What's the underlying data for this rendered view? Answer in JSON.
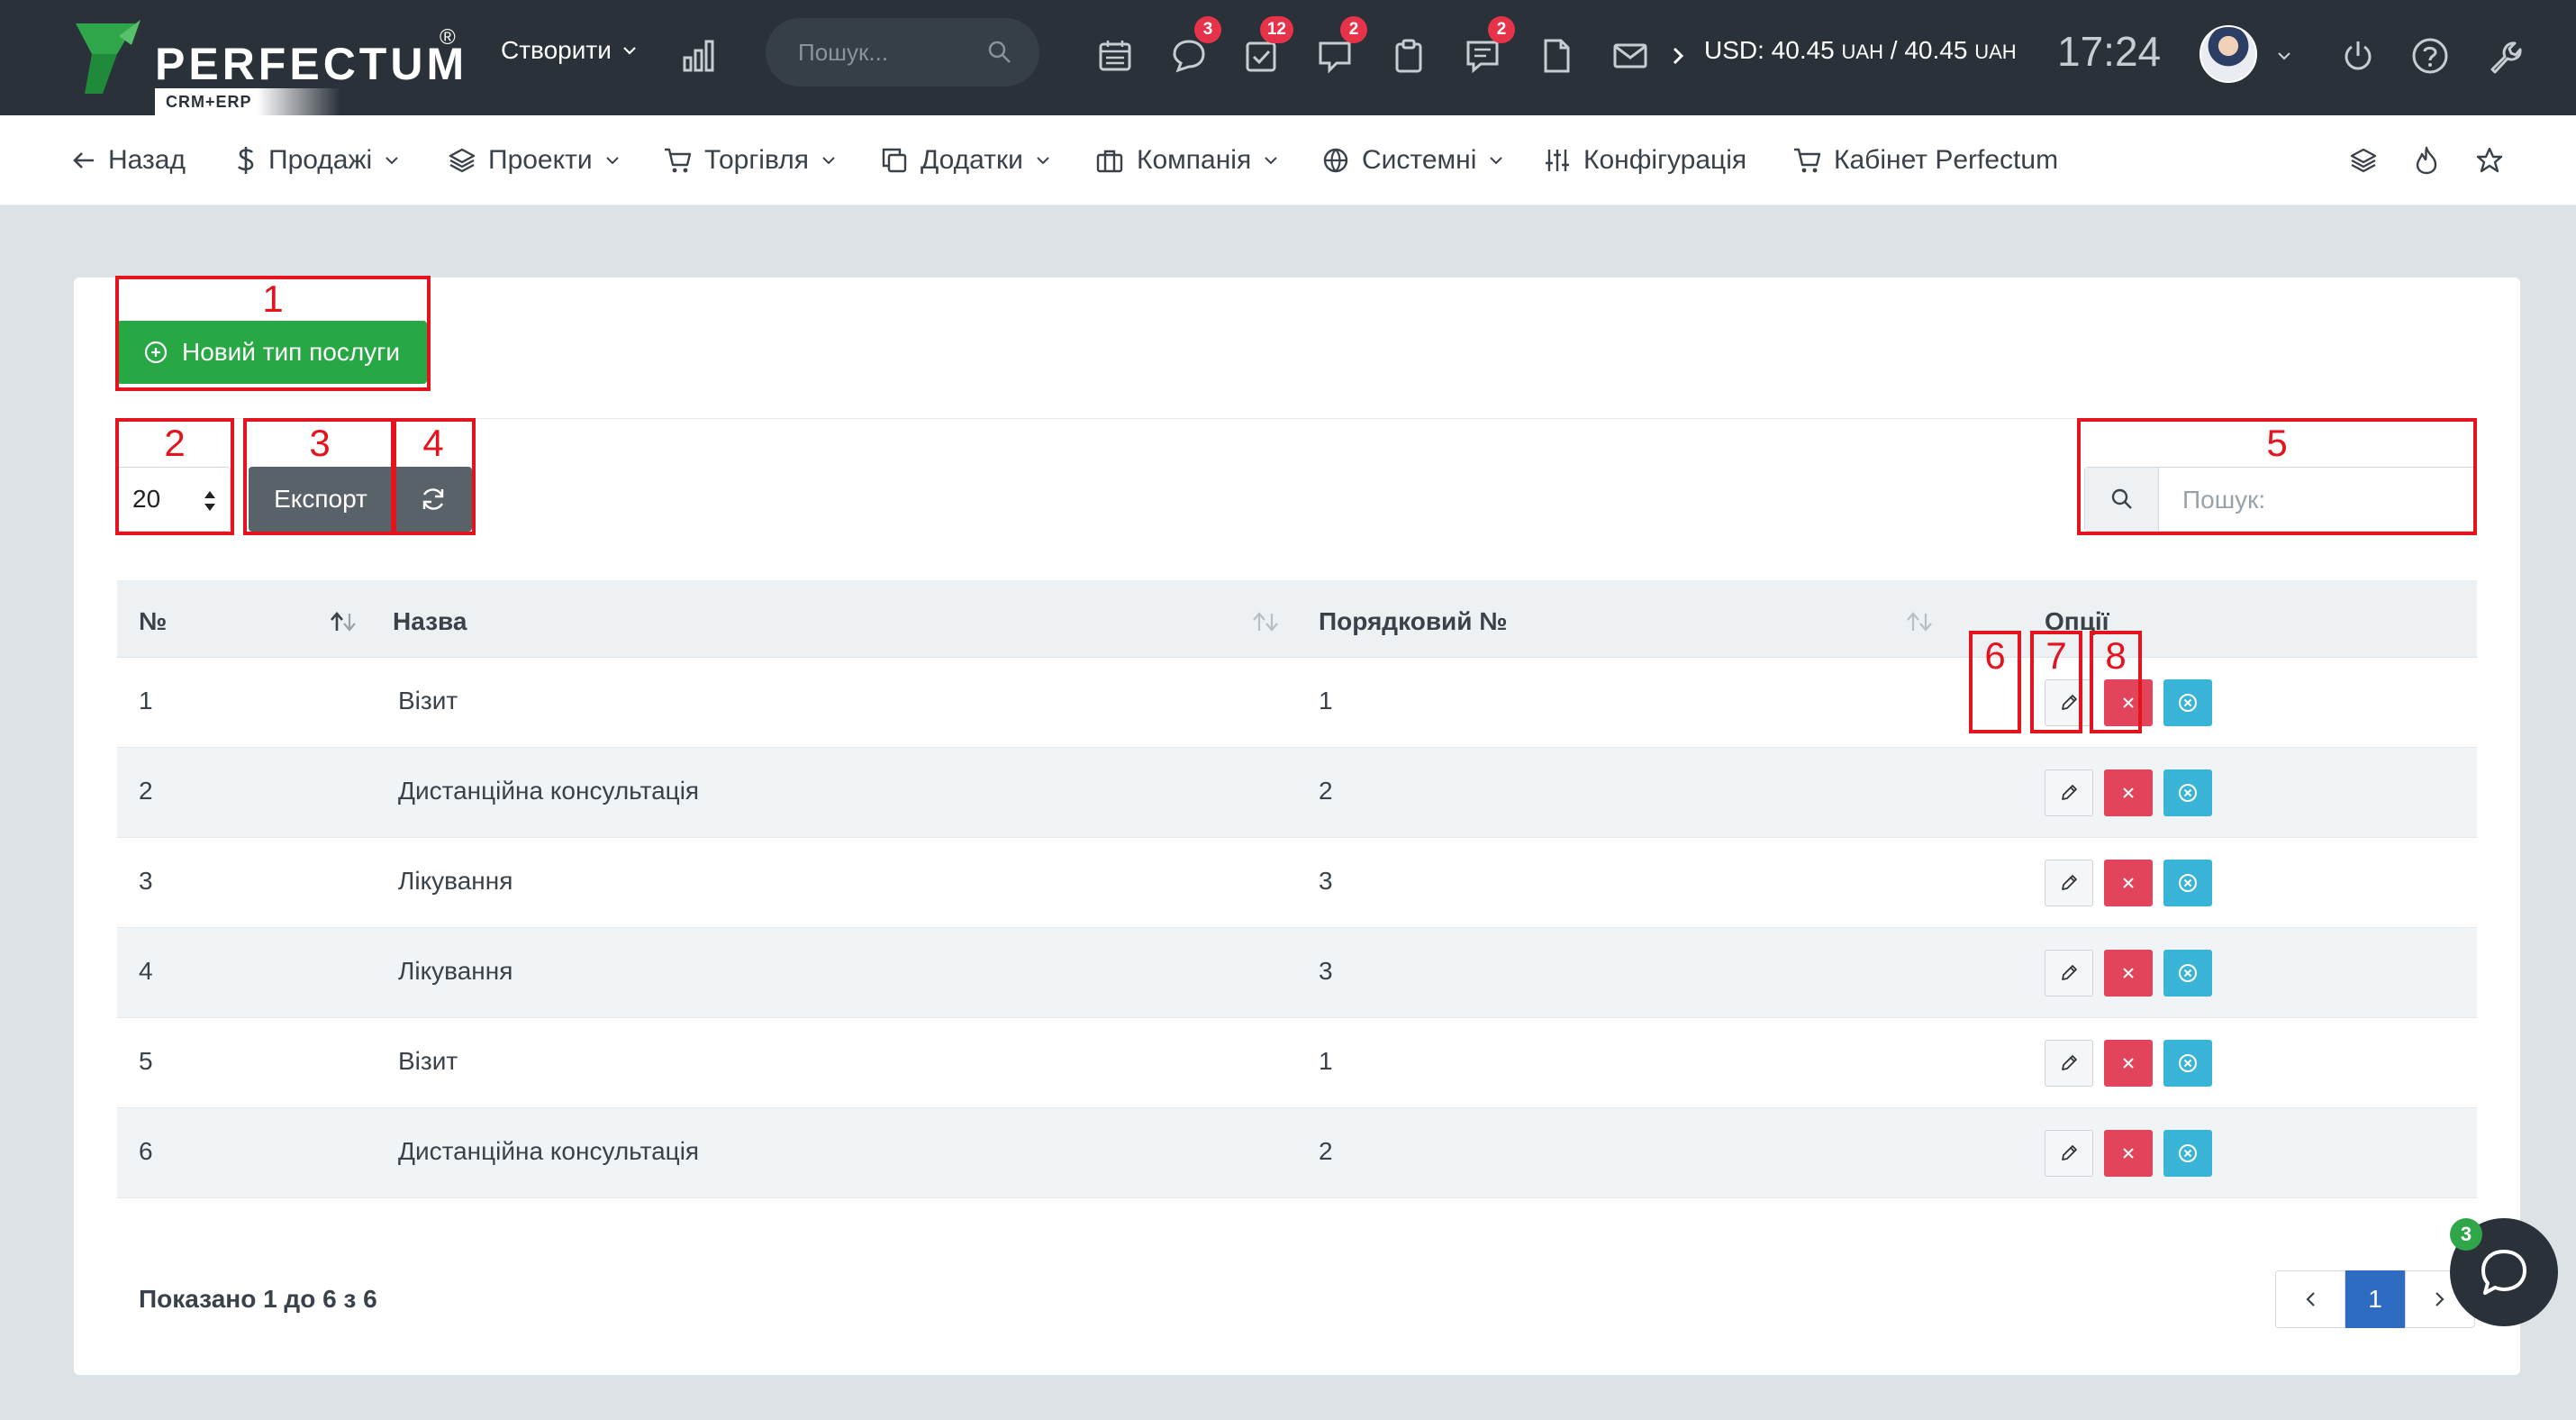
{
  "topbar": {
    "logo_text": "PERFECTUM",
    "logo_reg": "®",
    "logo_sub": "CRM+ERP",
    "create_label": "Створити",
    "search_placeholder": "Пошук...",
    "badges": {
      "chat": "3",
      "tasks": "12",
      "messages": "2",
      "notes": "2"
    },
    "currency_text": "USD: 40.45",
    "currency_unit1": "UAH",
    "currency_sep": "/ 40.45",
    "currency_unit2": "UAH",
    "time": "17:24"
  },
  "nav": {
    "back": "Назад",
    "sales": "Продажі",
    "projects": "Проекти",
    "trade": "Торгівля",
    "addons": "Додатки",
    "company": "Компанія",
    "system": "Системні",
    "config": "Конфігурація",
    "cabinet": "Кабінет Perfectum"
  },
  "toolbar": {
    "new_button": "Новий тип послуги",
    "page_size": "20",
    "export_button": "Експорт",
    "search_placeholder": "Пошук:"
  },
  "table": {
    "columns": [
      "№",
      "Назва",
      "Порядковий №",
      "Опції"
    ],
    "rows": [
      {
        "num": "1",
        "name": "Візит",
        "order": "1"
      },
      {
        "num": "2",
        "name": "Дистанційна консультація",
        "order": "2"
      },
      {
        "num": "3",
        "name": "Лікування",
        "order": "3"
      },
      {
        "num": "4",
        "name": "Лікування",
        "order": "3"
      },
      {
        "num": "5",
        "name": "Візит",
        "order": "1"
      },
      {
        "num": "6",
        "name": "Дистанційна консультація",
        "order": "2"
      }
    ]
  },
  "footer": {
    "info": "Показано 1 до 6 з 6",
    "current_page": "1"
  },
  "chat_badge": "3",
  "annotations": [
    "1",
    "2",
    "3",
    "4",
    "5",
    "6",
    "7",
    "8"
  ],
  "colors": {
    "topbar": "#2a3139",
    "primary_green": "#28a745",
    "danger": "#e2445c",
    "info": "#3ab4d6",
    "annotation": "#e3141d",
    "page_active": "#2d6cc0"
  }
}
